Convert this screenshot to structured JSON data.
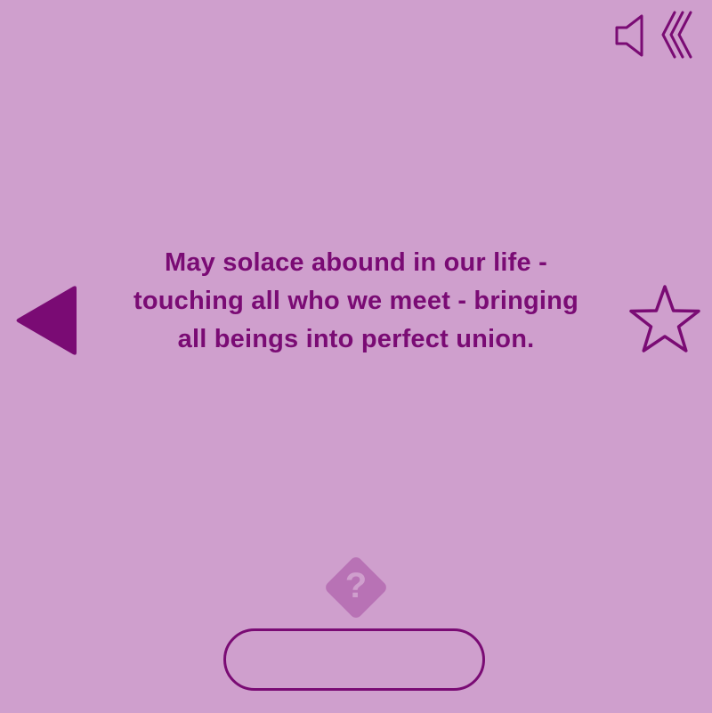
{
  "card": {
    "text": "May solace abound in our life - touching all who we meet - bringing all beings into perfect union."
  },
  "toolbar": {
    "sound_icon": "speaker-icon",
    "back_icon": "triple-chevron-left-icon"
  },
  "navigation": {
    "previous_icon": "triangle-left-icon",
    "favorite_icon": "star-outline-icon"
  },
  "hint": {
    "icon": "question-diamond-icon",
    "symbol": "?"
  },
  "answer_button": {
    "label": ""
  },
  "colors": {
    "background": "#cf9fcd",
    "accent": "#7a0b74",
    "hint_fill": "#b872b5"
  }
}
